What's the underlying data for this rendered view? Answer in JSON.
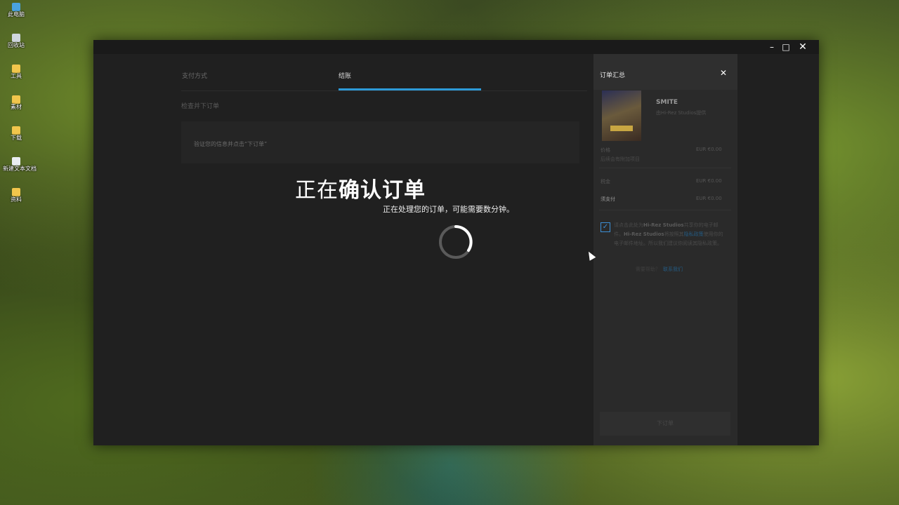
{
  "desktop": {
    "icons": [
      {
        "label": "此电脑",
        "icon": "computer-icon"
      },
      {
        "label": "回收站",
        "icon": "recycle-bin-icon"
      },
      {
        "label": "工具",
        "icon": "folder-icon"
      },
      {
        "label": "素材",
        "icon": "folder-icon"
      },
      {
        "label": "下载",
        "icon": "folder-icon"
      },
      {
        "label": "新建文本文档",
        "icon": "text-document-icon"
      },
      {
        "label": "资料",
        "icon": "folder-icon"
      }
    ]
  },
  "window": {
    "controls": {
      "minimize": "–",
      "maximize": "□",
      "close": "✕"
    }
  },
  "checkout": {
    "tabs": [
      {
        "label": "支付方式",
        "active": false
      },
      {
        "label": "结账",
        "active": true
      }
    ],
    "review_heading": "检查并下订单",
    "verify_text": "验证您的信息并点击“下订单”",
    "accent_color": "#2d9bd8"
  },
  "overlay": {
    "title_prefix": "正在",
    "title_bold": "确认订单",
    "subtitle": "正在处理您的订单，可能需要数分钟。"
  },
  "summary": {
    "title": "订单汇总",
    "close_icon": "close-icon",
    "game_name": "SMITE",
    "publisher": "由Hi-Rez Studios提供",
    "price_label": "价格",
    "price_value": "EUR €0.00",
    "price_note": "后续会有附加项目",
    "tax_label": "税金",
    "tax_value": "EUR €0.00",
    "due_label": "须支付",
    "due_value": "EUR €0.00",
    "consent_checked": true,
    "consent": {
      "part1": "请点击此处为",
      "studio1": "Hi-Rez Studios",
      "part2": "共享你的电子邮件。",
      "studio2": "Hi-Rez Studios",
      "part3": "将按照其",
      "link": "隐私政策",
      "part4": "使用你的电子邮件地址。所以我们建议你阅读其隐私政策。"
    },
    "help_text": "需要帮助？",
    "help_link": "联系我们",
    "order_button": "下订单"
  }
}
